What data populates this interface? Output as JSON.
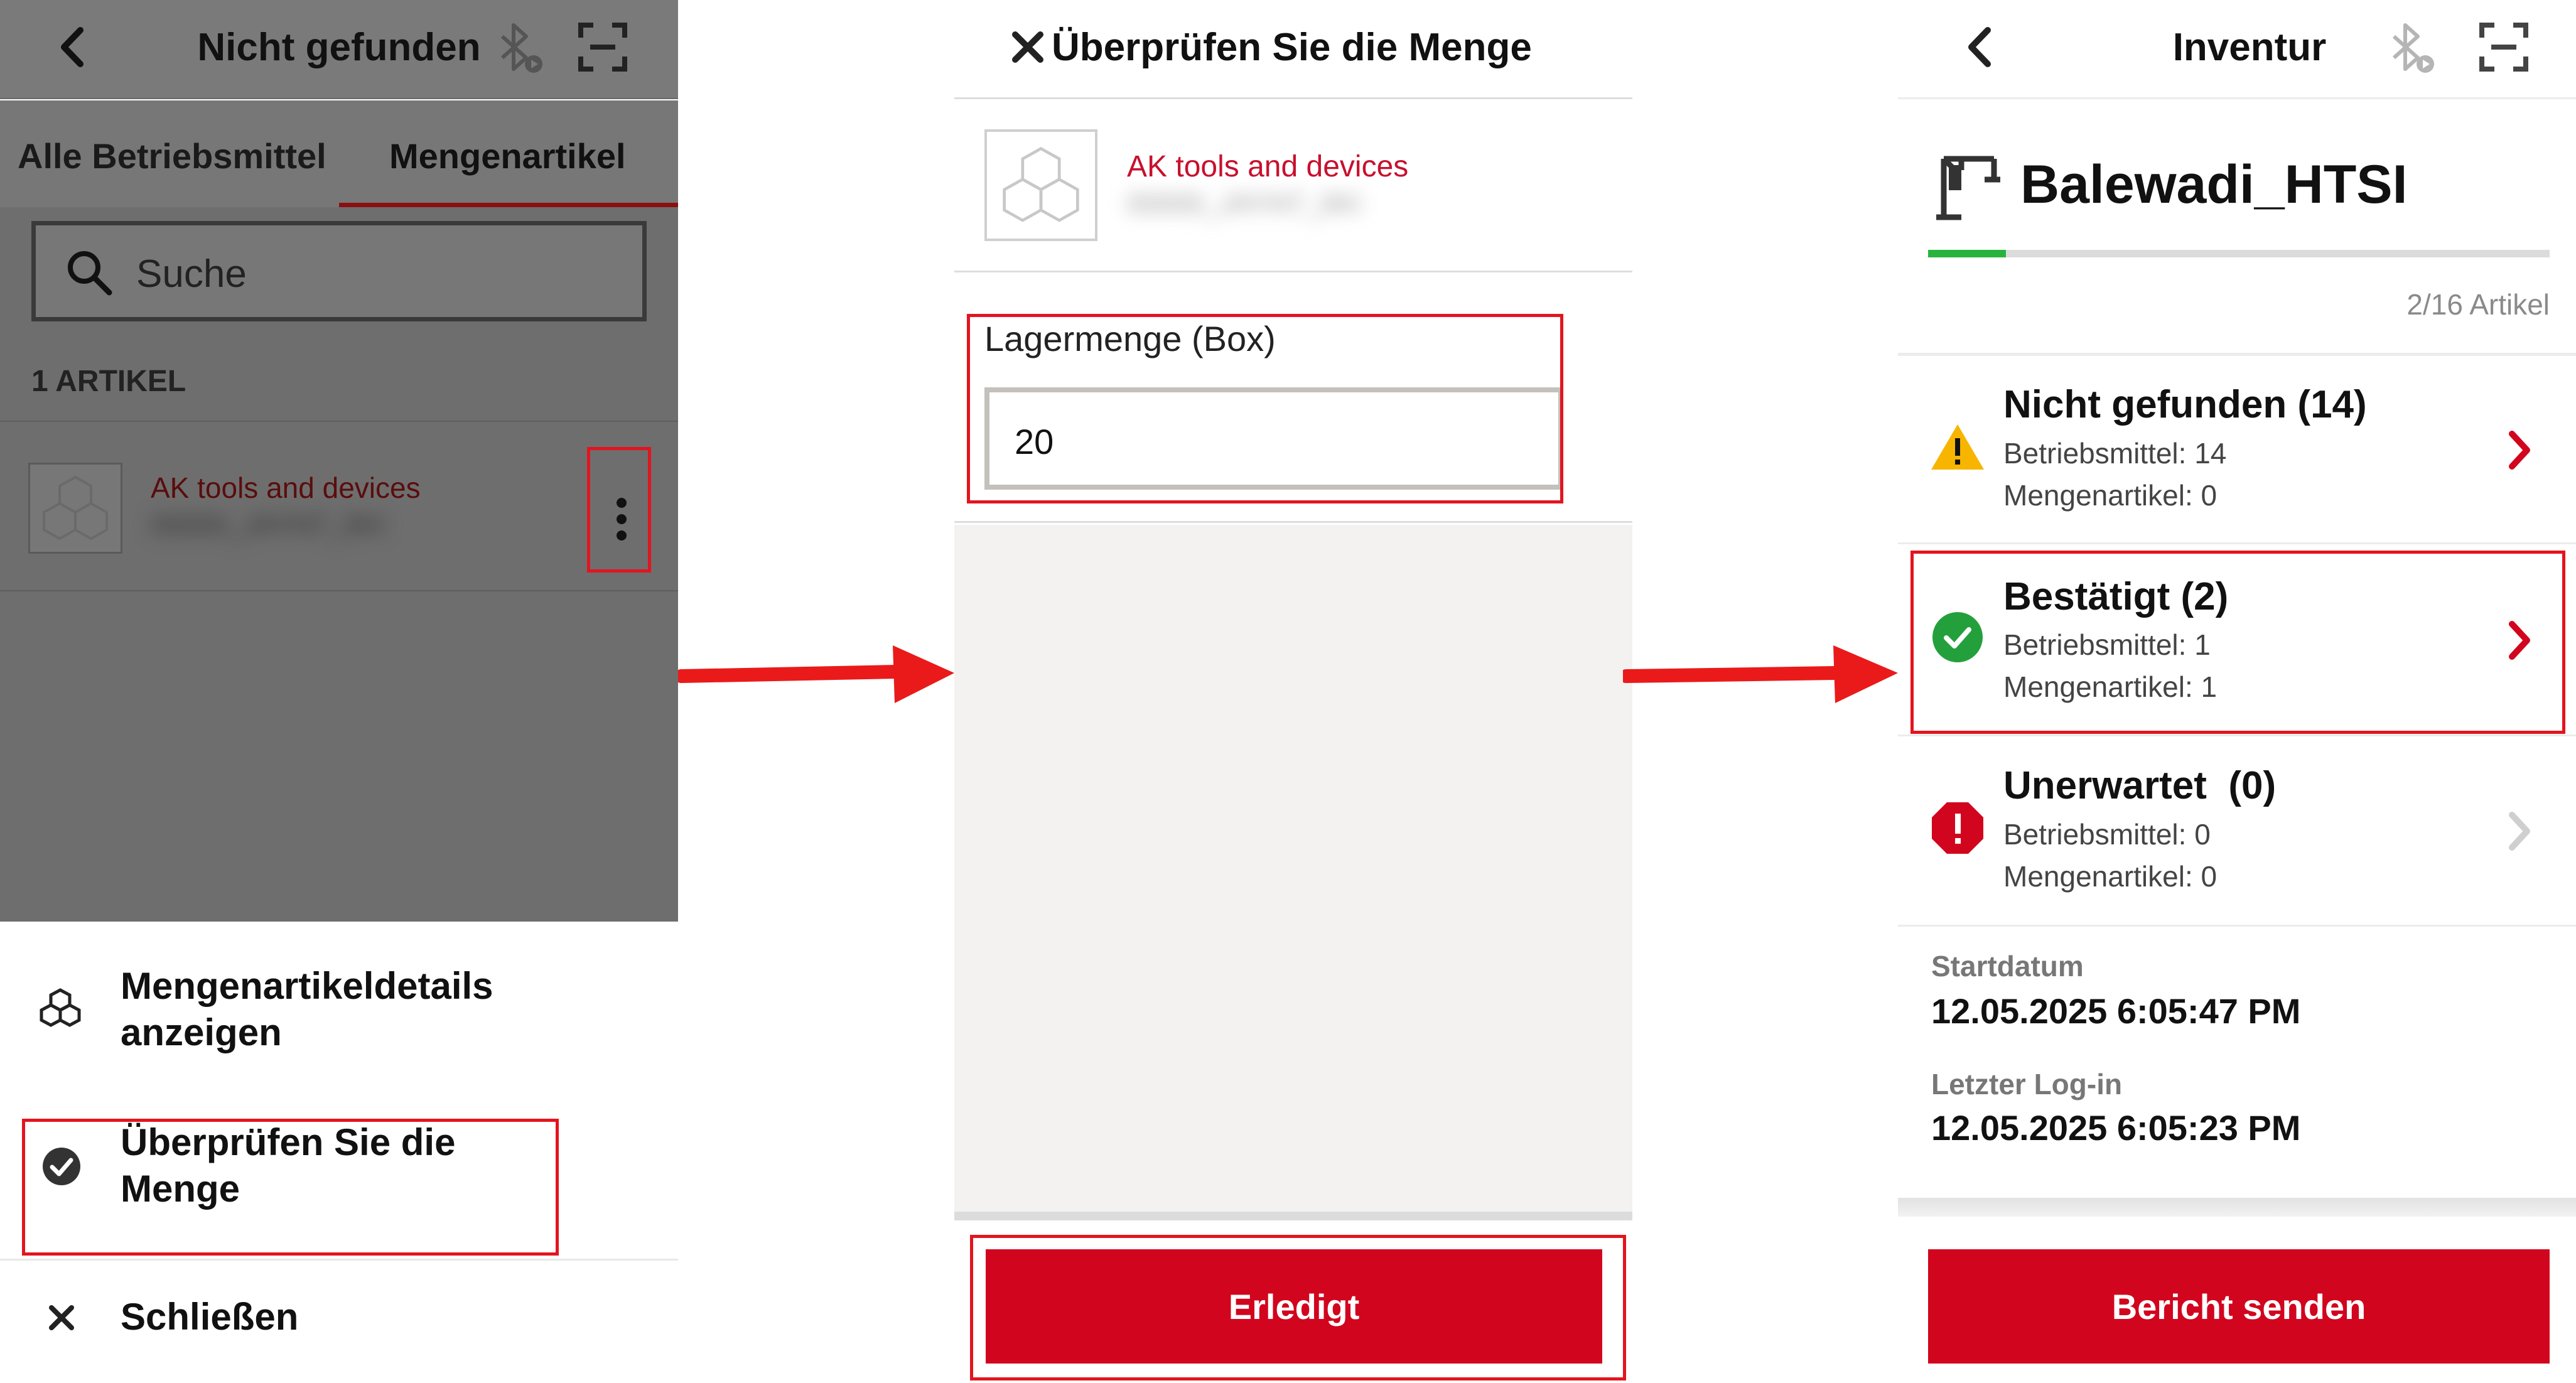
{
  "panel1": {
    "header": {
      "title": "Nicht gefunden"
    },
    "tabs": [
      {
        "label": "Alle Betriebsmittel"
      },
      {
        "label": "Mengenartikel"
      }
    ],
    "search": {
      "placeholder": "Suche"
    },
    "count_label": "1 ARTIKEL",
    "item": {
      "name": "AK tools and devices",
      "code": "00000_JAYNT_0KI"
    },
    "sheet": {
      "details_label": "Mengenartikeldetails anzeigen",
      "verify_label": "Überprüfen Sie die Menge",
      "close_label": "Schließen"
    }
  },
  "panel2": {
    "header": {
      "title": "Überprüfen Sie die Menge"
    },
    "item": {
      "name": "AK tools and devices",
      "code": "00000_JAYNT_0KI"
    },
    "field": {
      "label": "Lagermenge (Box)",
      "value": "20"
    },
    "done_button": "Erledigt"
  },
  "panel3": {
    "header": {
      "title": "Inventur"
    },
    "site": {
      "name": "Balewadi_HTSI"
    },
    "progress": {
      "fraction": 0.125,
      "label": "2/16 Artikel"
    },
    "sections": [
      {
        "title": "Nicht gefunden (14)",
        "line1": "Betriebsmittel: 14",
        "line2": "Mengenartikel: 0",
        "status": "warning"
      },
      {
        "title": "Bestätigt (2)",
        "line1": "Betriebsmittel: 1",
        "line2": "Mengenartikel: 1",
        "status": "confirmed"
      },
      {
        "title": "Unerwartet  (0)",
        "line1": "Betriebsmittel: 0",
        "line2": "Mengenartikel: 0",
        "status": "error"
      }
    ],
    "start": {
      "label": "Startdatum",
      "value": "12.05.2025 6:05:47 PM"
    },
    "last_login": {
      "label": "Letzter Log-in",
      "value": "12.05.2025 6:05:23 PM"
    },
    "report_button": "Bericht senden"
  },
  "colors": {
    "brand_red": "#d2051e",
    "highlight_red": "#e3141e",
    "progress_green": "#28b43c",
    "warning_yellow": "#f7b500",
    "success_green": "#23a03c"
  },
  "icons": [
    "back-arrow-icon",
    "bluetooth-off-icon",
    "scan-icon",
    "search-icon",
    "cubes-icon",
    "more-vertical-icon",
    "check-circle-icon",
    "close-icon",
    "crane-icon",
    "warning-icon",
    "error-octagon-icon",
    "chevron-right-icon",
    "flow-arrow-icon"
  ]
}
